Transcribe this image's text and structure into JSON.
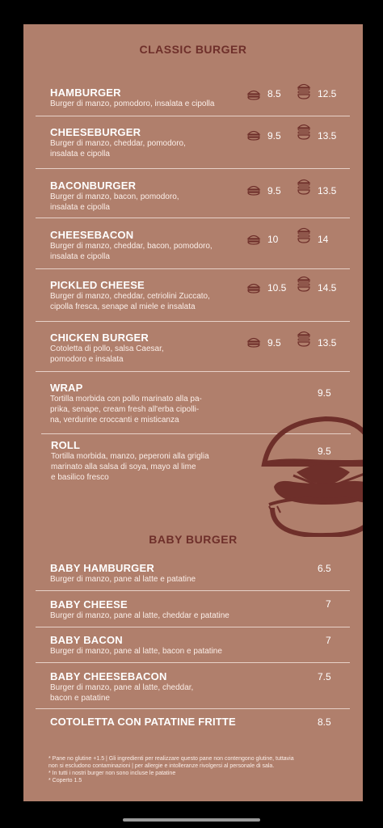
{
  "classic": {
    "title": "CLASSIC BURGER",
    "items": [
      {
        "name": "HAMBURGER",
        "desc1": "Burger di manzo, pomodoro, insalata e cipolla",
        "desc2": "",
        "single": "8.5",
        "double": "12.5"
      },
      {
        "name": "CHEESEBURGER",
        "desc1": "Burger di manzo, cheddar, pomodoro,",
        "desc2": "insalata e cipolla",
        "single": "9.5",
        "double": "13.5"
      },
      {
        "name": "BACONBURGER",
        "desc1": "Burger di manzo, bacon, pomodoro,",
        "desc2": "insalata e cipolla",
        "single": "9.5",
        "double": "13.5"
      },
      {
        "name": "CHEESEBACON",
        "desc1": "Burger di manzo, cheddar, bacon, pomodoro,",
        "desc2": "insalata e cipolla",
        "single": "10",
        "double": "14"
      },
      {
        "name": "PICKLED CHEESE",
        "desc1": "Burger di manzo, cheddar, cetriolini Zuccato,",
        "desc2": "cipolla fresca, senape al miele e insalata",
        "single": "10.5",
        "double": "14.5"
      },
      {
        "name": "CHICKEN BURGER",
        "desc1": "Cotoletta di pollo, salsa Caesar,",
        "desc2": "pomodoro e insalata",
        "single": "9.5",
        "double": "13.5"
      }
    ],
    "wrap": {
      "name": "WRAP",
      "desc1": "Tortilla morbida con pollo marinato alla pa-",
      "desc2": "prika, senape, cream fresh all'erba cipolli-",
      "desc3": "na, verdurine croccanti e misticanza",
      "price": "9.5"
    },
    "roll": {
      "name": "ROLL",
      "desc1": "Tortilla morbida, manzo, peperoni alla griglia",
      "desc2": "marinato alla salsa di soya, mayo al lime",
      "desc3": "e basilico fresco",
      "price": "9.5"
    }
  },
  "baby": {
    "title": "BABY BURGER",
    "items": [
      {
        "name": "BABY HAMBURGER",
        "desc1": "Burger di manzo, pane al latte e patatine",
        "desc2": "",
        "price": "6.5"
      },
      {
        "name": "BABY CHEESE",
        "desc1": "Burger di manzo, pane al latte, cheddar e patatine",
        "desc2": "",
        "price": "7"
      },
      {
        "name": "BABY BACON",
        "desc1": "Burger di manzo, pane al latte, bacon e patatine",
        "desc2": "",
        "price": "7"
      },
      {
        "name": "BABY CHEESEBACON",
        "desc1": "Burger di manzo, pane al latte, cheddar,",
        "desc2": "bacon e patatine",
        "price": "7.5"
      },
      {
        "name": "COTOLETTA CON PATATINE FRITTE",
        "desc1": "",
        "desc2": "",
        "price": "8.5"
      }
    ]
  },
  "footnotes": {
    "line1": "* Pane no glutine +1.5 | Gli ingredienti per realizzare questo pane non contengono glutine, tuttavia",
    "line2": "non si escludono contaminazioni | per allergie e intolleranze rivolgersi al personale di sala.",
    "line3": "* In tutti i nostri burger non sono incluse le patatine",
    "line4": "* Coperto 1.5"
  },
  "icons": {
    "single": "single-burger-icon",
    "double": "double-burger-icon",
    "illustration": "burger-illustration"
  },
  "colors": {
    "background": "#b07f6c",
    "accent": "#6e2f2a",
    "text": "#ffffff"
  }
}
